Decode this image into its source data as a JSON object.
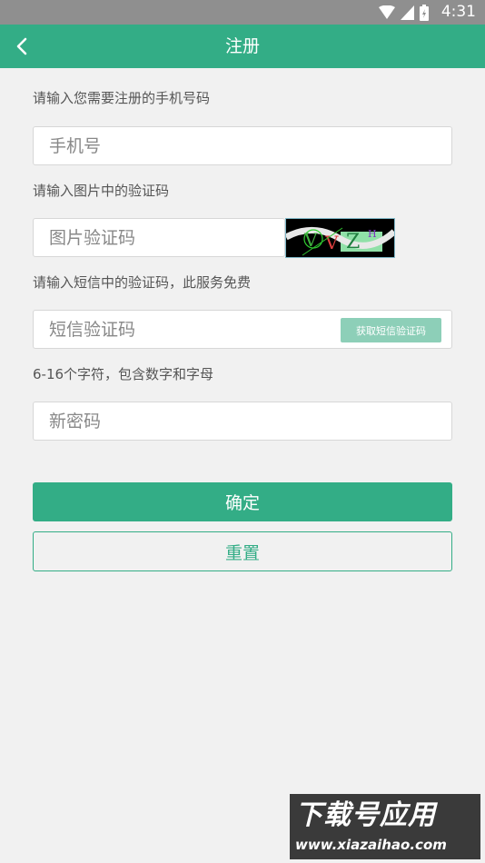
{
  "status_bar": {
    "time": "4:31"
  },
  "app_bar": {
    "title": "注册"
  },
  "form": {
    "phone_label": "请输入您需要注册的手机号码",
    "phone_placeholder": "手机号",
    "captcha_label": "请输入图片中的验证码",
    "captcha_placeholder": "图片验证码",
    "captcha_image_text": "VVZH",
    "sms_label": "请输入短信中的验证码，此服务免费",
    "sms_placeholder": "短信验证码",
    "sms_button": "获取短信验证码",
    "password_label": "6-16个字符，包含数字和字母",
    "password_placeholder": "新密码"
  },
  "buttons": {
    "confirm": "确定",
    "reset": "重置"
  },
  "watermark": {
    "brand": "下载号应用",
    "url": "www.xiazaihao.com"
  },
  "colors": {
    "accent": "#33ad86",
    "status_bar": "#8f8f8f",
    "background": "#f1f1f1"
  }
}
